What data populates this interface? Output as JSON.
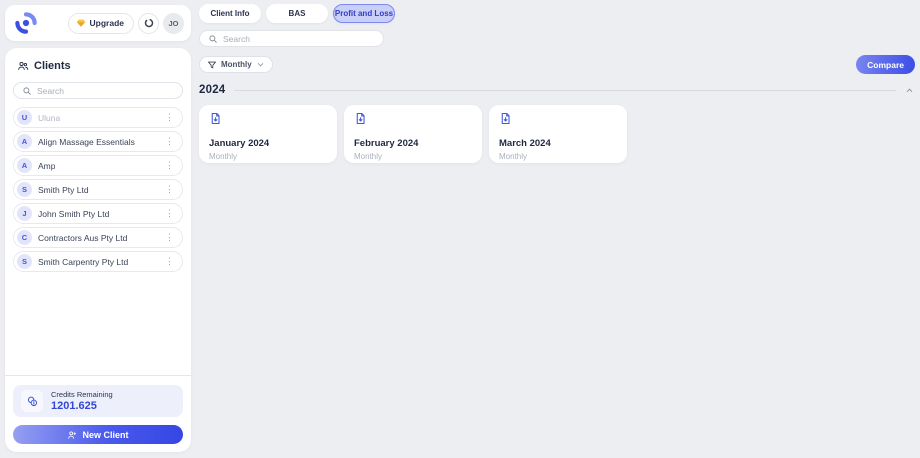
{
  "topbar": {
    "upgrade_label": "Upgrade",
    "avatar_initials": "JO"
  },
  "sidebar": {
    "title": "Clients",
    "search_placeholder": "Search",
    "clients": [
      {
        "initial": "U",
        "name": "Uluna",
        "muted": true
      },
      {
        "initial": "A",
        "name": "Align Massage Essentials"
      },
      {
        "initial": "A",
        "name": "Amp"
      },
      {
        "initial": "S",
        "name": "Smith Pty Ltd"
      },
      {
        "initial": "J",
        "name": "John Smith Pty Ltd"
      },
      {
        "initial": "C",
        "name": "Contractors Aus Pty Ltd"
      },
      {
        "initial": "S",
        "name": "Smith Carpentry Pty Ltd"
      }
    ],
    "credits": {
      "label": "Credits Remaining",
      "value": "1201.625"
    },
    "new_client_label": "New Client"
  },
  "main": {
    "tabs": [
      {
        "label": "Client Info",
        "active": false
      },
      {
        "label": "BAS",
        "active": false
      },
      {
        "label": "Profit and Loss",
        "active": true
      }
    ],
    "search_placeholder": "Search",
    "filter_label": "Monthly",
    "compare_label": "Compare",
    "section": {
      "year": "2024",
      "reports": [
        {
          "title": "January 2024",
          "subtitle": "Monthly"
        },
        {
          "title": "February 2024",
          "subtitle": "Monthly"
        },
        {
          "title": "March 2024",
          "subtitle": "Monthly"
        }
      ]
    }
  },
  "icons": {
    "brand": "swirl-circle",
    "upgrade": "gem",
    "topbar_circle": "ring",
    "clients_header": "people",
    "search": "magnifier",
    "client_row_menu": "kebab-vertical-dots",
    "credits": "coins",
    "new_client": "person-plus",
    "filter": "funnel",
    "filter_caret": "chevron-down",
    "year_collapse": "chevron-up",
    "report": "document-download"
  },
  "colors": {
    "background": "#edeef2",
    "accent_blue": "#3b4ce6",
    "active_tab_bg": "#cacff7",
    "active_tab_border": "#7d87ef",
    "avatar_bg": "#e2e5fa",
    "avatar_text": "#4356d8",
    "credits_panel_bg": "#edeffb",
    "credits_value": "#3347d6",
    "gem_yellow": "#f6c445",
    "muted_text": "#aab0bb"
  }
}
